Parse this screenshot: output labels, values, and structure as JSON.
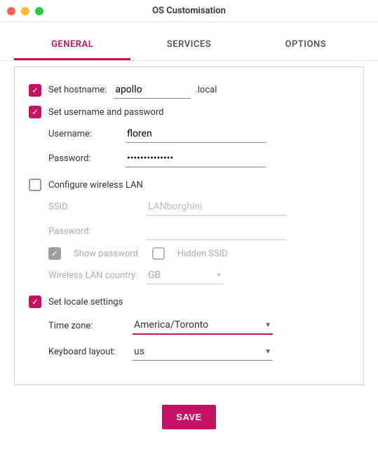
{
  "window": {
    "title": "OS Customisation"
  },
  "tabs": {
    "general": "GENERAL",
    "services": "SERVICES",
    "options": "OPTIONS"
  },
  "hostname": {
    "label": "Set hostname:",
    "value": "apollo",
    "suffix": ".local"
  },
  "userpass": {
    "label": "Set username and password",
    "username_label": "Username:",
    "username_value": "floren",
    "password_label": "Password:",
    "password_value": "••••••••••••••"
  },
  "wlan": {
    "label": "Configure wireless LAN",
    "ssid_label": "SSID:",
    "ssid_placeholder": "LANborghini",
    "password_label": "Password:",
    "password_value": "",
    "show_password": "Show password",
    "hidden_ssid": "Hidden SSID",
    "country_label": "Wireless LAN country:",
    "country_value": "GB"
  },
  "locale": {
    "label": "Set locale settings",
    "tz_label": "Time zone:",
    "tz_value": "America/Toronto",
    "kb_label": "Keyboard layout:",
    "kb_value": "us"
  },
  "save": "SAVE"
}
